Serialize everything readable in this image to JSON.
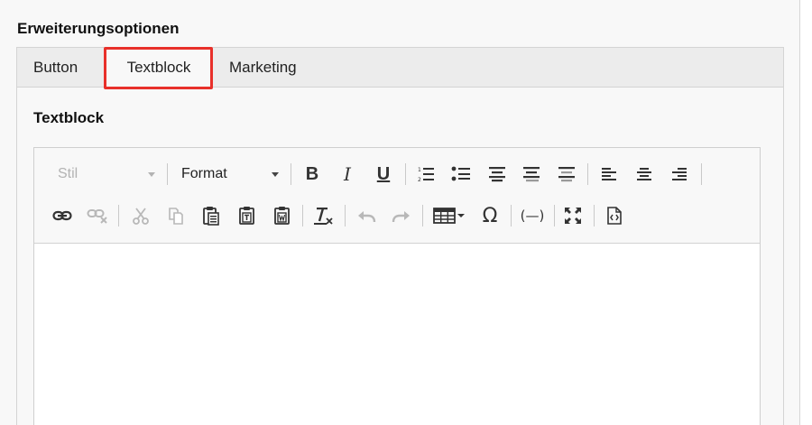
{
  "section": {
    "title": "Erweiterungsoptionen"
  },
  "tabs": [
    {
      "label": "Button",
      "active": false
    },
    {
      "label": "Textblock",
      "active": true
    },
    {
      "label": "Marketing",
      "active": false
    }
  ],
  "panel": {
    "title": "Textblock"
  },
  "toolbar": {
    "style_combo": {
      "label": "Stil",
      "disabled": true
    },
    "format_combo": {
      "label": "Format",
      "disabled": false
    },
    "bold_label": "B",
    "italic_label": "I",
    "underline_label": "U",
    "omega_label": "Ω",
    "placeholder_label": "(—)"
  },
  "colors": {
    "highlight": "#e8302a",
    "icon": "#333333",
    "icon_disabled": "#b8b8b8"
  },
  "icons": [
    "numbered-list-icon",
    "bulleted-list-icon",
    "decrease-indent-icon",
    "increase-indent-icon",
    "blockquote-icon",
    "align-left-icon",
    "align-center-icon",
    "align-right-icon",
    "link-icon",
    "unlink-icon",
    "cut-icon",
    "copy-icon",
    "paste-icon",
    "paste-text-icon",
    "paste-word-icon",
    "remove-format-icon",
    "undo-icon",
    "redo-icon",
    "table-icon",
    "special-char-icon",
    "placeholder-icon",
    "maximize-icon",
    "source-icon"
  ]
}
